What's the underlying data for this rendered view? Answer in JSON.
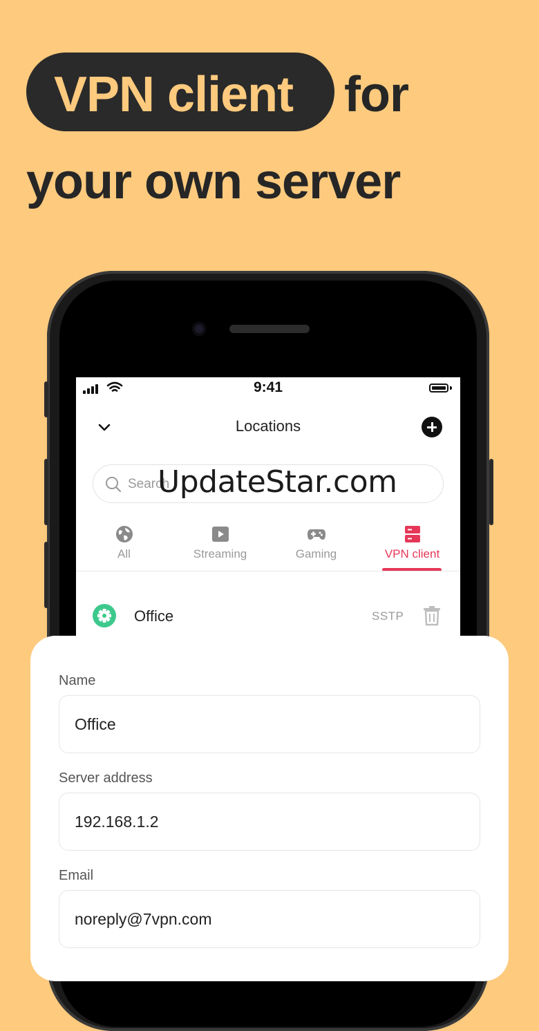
{
  "headline": {
    "highlight": "VPN client",
    "rest_line1": "for",
    "line2": "your own server"
  },
  "status_bar": {
    "time": "9:41"
  },
  "nav": {
    "title": "Locations"
  },
  "search": {
    "placeholder": "Search"
  },
  "tabs": [
    {
      "label": "All",
      "icon": "globe-icon"
    },
    {
      "label": "Streaming",
      "icon": "play-icon"
    },
    {
      "label": "Gaming",
      "icon": "gamepad-icon"
    },
    {
      "label": "VPN client",
      "icon": "server-icon",
      "active": true
    }
  ],
  "location_row": {
    "name": "Office",
    "protocol": "SSTP",
    "icon": "gear-icon"
  },
  "watermark": "UpdateStar.com",
  "form": {
    "name_label": "Name",
    "name_value": "Office",
    "server_label": "Server address",
    "server_value": "192.168.1.2",
    "email_label": "Email",
    "email_value": "noreply@7vpn.com"
  },
  "colors": {
    "background": "#FDCA7E",
    "dark": "#2A2A2A",
    "accent": "#E63758",
    "status_green": "#3DC98D"
  }
}
